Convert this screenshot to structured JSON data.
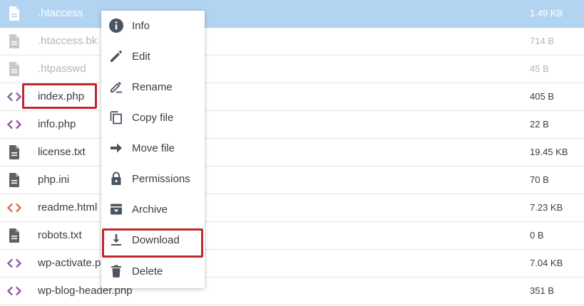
{
  "files": [
    {
      "name": ".htaccess",
      "size": "1.49 KB",
      "icon": "document-icon",
      "selected": true
    },
    {
      "name": ".htaccess.bk",
      "size": "714 B",
      "icon": "document-icon",
      "dim": true
    },
    {
      "name": ".htpasswd",
      "size": "45 B",
      "icon": "document-icon",
      "dim": true
    },
    {
      "name": "index.php",
      "size": "405 B",
      "icon": "code-icon"
    },
    {
      "name": "info.php",
      "size": "22 B",
      "icon": "code-icon"
    },
    {
      "name": "license.txt",
      "size": "19.45 KB",
      "icon": "document-icon"
    },
    {
      "name": "php.ini",
      "size": "70 B",
      "icon": "document-icon"
    },
    {
      "name": "readme.html",
      "size": "7.23 KB",
      "icon": "html-code-icon"
    },
    {
      "name": "robots.txt",
      "size": "0 B",
      "icon": "document-icon"
    },
    {
      "name": "wp-activate.php",
      "size": "7.04 KB",
      "icon": "code-icon"
    },
    {
      "name": "wp-blog-header.php",
      "size": "351 B",
      "icon": "code-icon"
    }
  ],
  "context_menu": {
    "items": [
      {
        "label": "Info",
        "icon": "info-icon"
      },
      {
        "label": "Edit",
        "icon": "pencil-icon"
      },
      {
        "label": "Rename",
        "icon": "rename-icon"
      },
      {
        "label": "Copy file",
        "icon": "copy-icon"
      },
      {
        "label": "Move file",
        "icon": "arrow-right-icon"
      },
      {
        "label": "Permissions",
        "icon": "lock-icon"
      },
      {
        "label": "Archive",
        "icon": "archive-icon"
      },
      {
        "label": "Download",
        "icon": "download-icon"
      },
      {
        "label": "Delete",
        "icon": "trash-icon"
      }
    ]
  },
  "colors": {
    "selected_row": "#b3d4f1",
    "highlight": "#c0272d",
    "code_icon": "#8e5ea2",
    "html_icon": "#e06c4f",
    "doc_icon": "#616161",
    "doc_icon_dim": "#c8c8c8",
    "menu_icon": "#4a5560"
  }
}
